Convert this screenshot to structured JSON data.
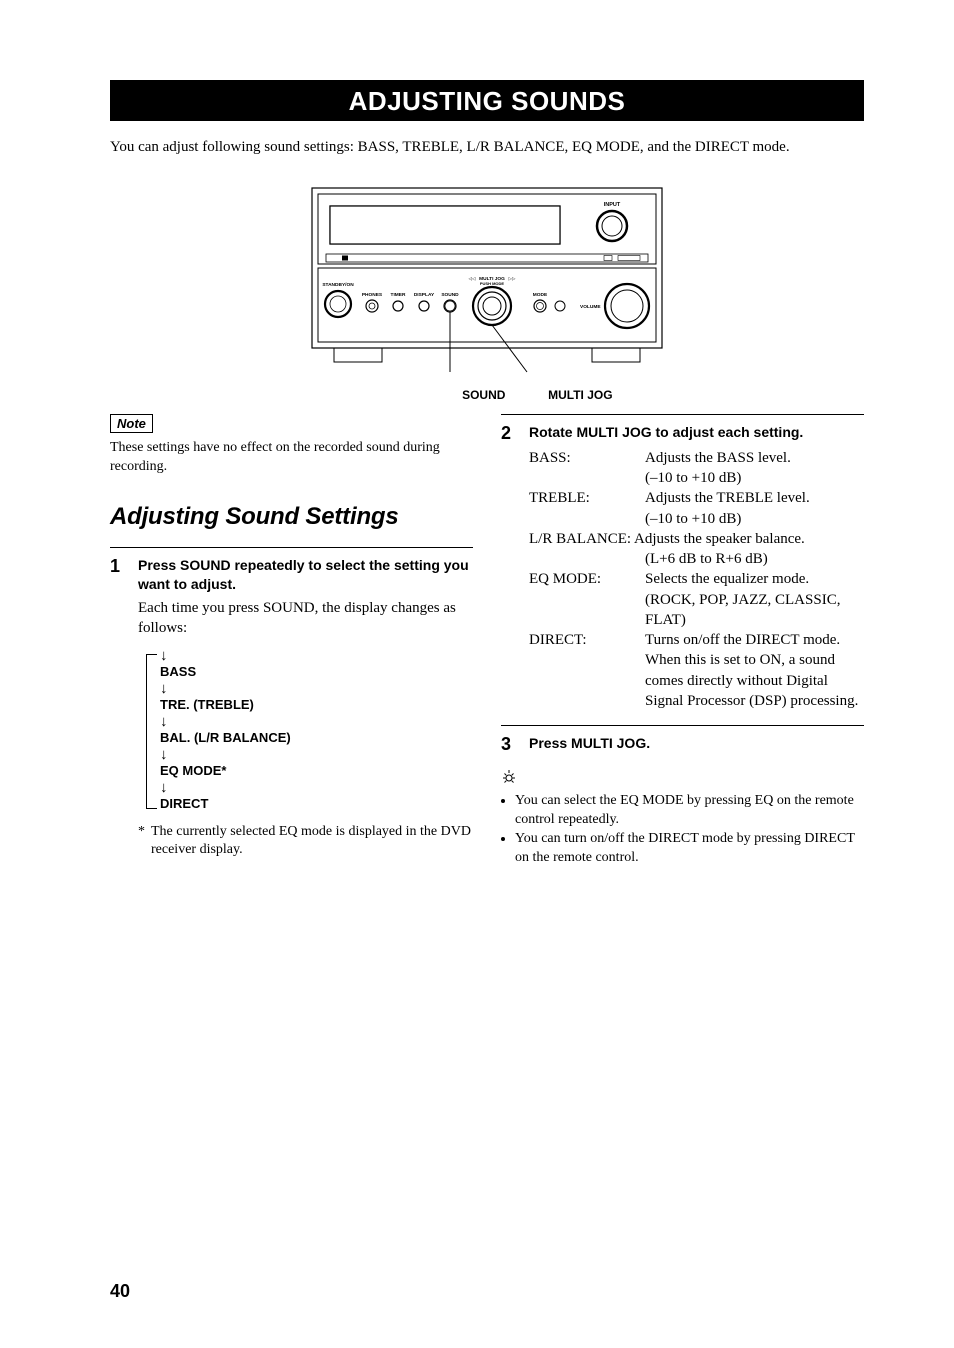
{
  "title": "ADJUSTING SOUNDS",
  "intro": "You can adjust following sound settings: BASS, TREBLE, L/R BALANCE, EQ MODE, and the DIRECT mode.",
  "diagram": {
    "label_sound": "SOUND",
    "label_multijog": "MULTI JOG",
    "panel_labels": {
      "input": "INPUT",
      "standby_on": "STANDBY/ON",
      "phones": "PHONES",
      "timer": "TIMER",
      "display": "DISPLAY",
      "sound": "SOUND",
      "multi_jog": "MULTI JOG",
      "push_mode": "PUSH MODE",
      "mode": "MODE",
      "volume": "VOLUME"
    }
  },
  "note": {
    "label": "Note",
    "text": "These settings have no effect on the recorded sound during recording."
  },
  "section_heading": "Adjusting Sound Settings",
  "step1": {
    "num": "1",
    "title": "Press SOUND repeatedly to select the setting you want to adjust.",
    "detail": "Each time you press SOUND, the display changes as follows:",
    "flow": [
      "BASS",
      "TRE. (TREBLE)",
      "BAL. (L/R BALANCE)",
      "EQ MODE*",
      "DIRECT"
    ],
    "footnote_mark": "*",
    "footnote": "The currently selected EQ mode is displayed in the DVD receiver display."
  },
  "step2": {
    "num": "2",
    "title": "Rotate MULTI JOG to adjust each setting.",
    "rows": [
      {
        "label": "BASS:",
        "desc": "Adjusts the BASS level.",
        "desc2": "(–10 to +10 dB)"
      },
      {
        "label": "TREBLE:",
        "desc": "Adjusts the TREBLE level.",
        "desc2": "(–10 to +10 dB)"
      },
      {
        "label": "L/R BALANCE:",
        "desc": "Adjusts the speaker balance.",
        "desc2": "(L+6 dB to R+6 dB)",
        "wide": true
      },
      {
        "label": "EQ MODE:",
        "desc": "Selects the equalizer mode.",
        "desc2": "(ROCK, POP, JAZZ, CLASSIC, FLAT)"
      },
      {
        "label": "DIRECT:",
        "desc": "Turns on/off the DIRECT mode. When this is set to ON, a sound comes directly without Digital Signal Processor (DSP) processing."
      }
    ]
  },
  "step3": {
    "num": "3",
    "title": "Press MULTI JOG."
  },
  "tips": [
    "You can select the EQ MODE by pressing EQ on the remote control repeatedly.",
    "You can turn on/off the DIRECT mode by pressing DIRECT on the remote control."
  ],
  "page_number": "40"
}
